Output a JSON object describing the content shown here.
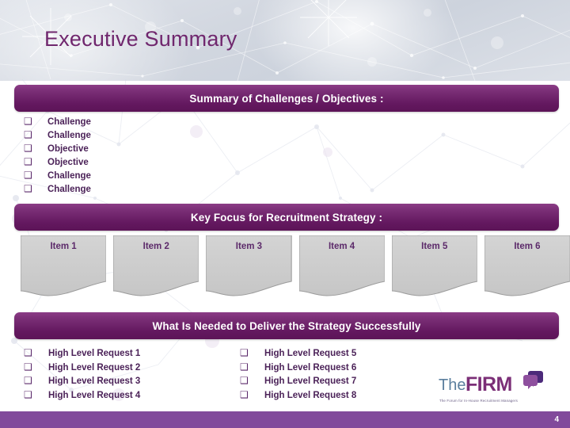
{
  "slide": {
    "title": "Executive Summary",
    "page_number": "4",
    "accent_purple": "#63185f",
    "footer_purple": "#814a9b",
    "title_color": "#70276e",
    "text_purple": "#4b2258",
    "box_grey": "#cccccc"
  },
  "sections": {
    "challenges": {
      "banner_label": "Summary of Challenges / Objectives :",
      "items": [
        {
          "bullet": "checkbox-empty",
          "label": "Challenge"
        },
        {
          "bullet": "checkbox-empty",
          "label": "Challenge"
        },
        {
          "bullet": "checkbox-empty",
          "label": "Objective"
        },
        {
          "bullet": "checkbox-empty",
          "label": "Objective"
        },
        {
          "bullet": "checkbox-empty",
          "label": "Challenge"
        },
        {
          "bullet": "checkbox-empty",
          "label": "Challenge"
        }
      ]
    },
    "key_focus": {
      "banner_label": "Key Focus for Recruitment Strategy :",
      "items": [
        {
          "label": "Item 1"
        },
        {
          "label": "Item 2"
        },
        {
          "label": "Item 3"
        },
        {
          "label": "Item 4"
        },
        {
          "label": "Item 5"
        },
        {
          "label": "Item 6"
        }
      ]
    },
    "needed": {
      "banner_label": "What Is Needed to Deliver the Strategy Successfully",
      "left_items": [
        {
          "bullet": "checkbox-empty",
          "label": "High Level Request 1"
        },
        {
          "bullet": "checkbox-empty",
          "label": "High Level Request 2"
        },
        {
          "bullet": "checkbox-empty",
          "label": "High Level Request 3"
        },
        {
          "bullet": "checkbox-empty",
          "label": "High Level Request 4"
        }
      ],
      "right_items": [
        {
          "bullet": "checkbox-empty",
          "label": "High Level Request 5"
        },
        {
          "bullet": "checkbox-empty",
          "label": "High Level Request 6"
        },
        {
          "bullet": "checkbox-empty",
          "label": "High Level Request 7"
        },
        {
          "bullet": "checkbox-empty",
          "label": "High Level Request 8"
        }
      ]
    }
  },
  "logo": {
    "word_the": "The",
    "word_firm": "FIRM",
    "tagline": "The Forum for In-House Recruitment Managers",
    "the_color": "#5b7f9e",
    "firm_color": "#7b2f77",
    "mark_color": "#8e4f9e"
  }
}
